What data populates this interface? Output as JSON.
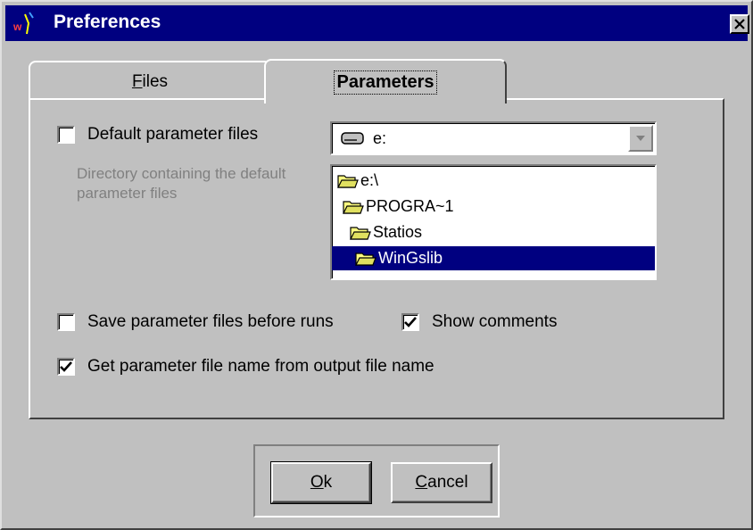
{
  "window": {
    "title": "Preferences"
  },
  "tabs": [
    {
      "label": "Files",
      "mnemonic": "F",
      "rest": "iles",
      "selected": false
    },
    {
      "label": "Parameters",
      "selected": true
    }
  ],
  "parameters": {
    "default_param_files": {
      "label": "Default parameter files",
      "checked": false
    },
    "directory_hint": "Directory containing the default parameter files",
    "drive": {
      "value": "e:",
      "icon": "drive-icon"
    },
    "directories": [
      {
        "label": "e:\\",
        "selected": false
      },
      {
        "label": "PROGRA~1",
        "selected": false
      },
      {
        "label": "Statios",
        "selected": false
      },
      {
        "label": "WinGslib",
        "selected": true
      }
    ],
    "save_before_runs": {
      "label": "Save parameter files before runs",
      "checked": false
    },
    "show_comments": {
      "label": "Show comments",
      "checked": true
    },
    "name_from_output": {
      "label": "Get parameter file name from output file name",
      "checked": true
    }
  },
  "buttons": {
    "ok": {
      "label": "Ok",
      "mnemonic": "O",
      "rest": "k"
    },
    "cancel": {
      "label": "Cancel",
      "mnemonic": "C",
      "rest": "ancel"
    }
  },
  "colors": {
    "titlebar": "#000080",
    "face": "#c0c0c0",
    "selection": "#000080",
    "disabled_text": "#808080"
  }
}
